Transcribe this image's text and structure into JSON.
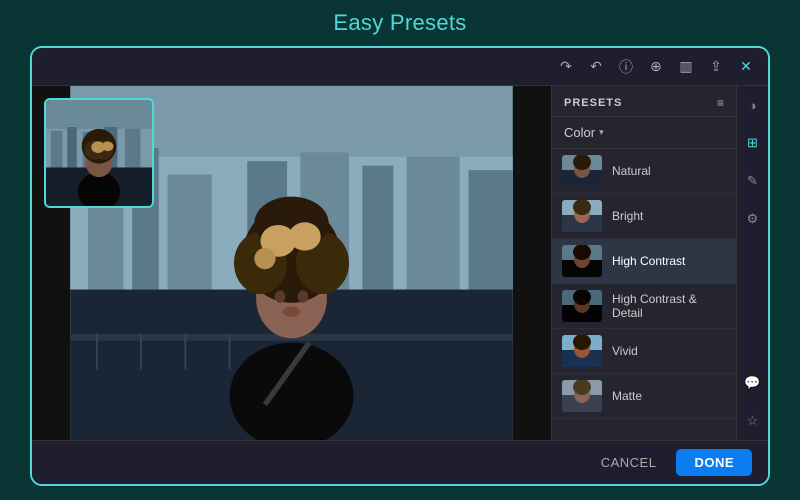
{
  "page": {
    "title": "Easy Presets",
    "background_color": "#0a3535",
    "accent_color": "#4fd8d8"
  },
  "toolbar": {
    "icons": [
      "redo",
      "undo",
      "info",
      "add",
      "compare",
      "share",
      "settings"
    ]
  },
  "presets_panel": {
    "title": "PRESETS",
    "filter_label": "Color",
    "items": [
      {
        "id": 1,
        "name": "Natural",
        "active": false
      },
      {
        "id": 2,
        "name": "Bright",
        "active": false
      },
      {
        "id": 3,
        "name": "High Contrast",
        "active": true
      },
      {
        "id": 4,
        "name": "High Contrast & Detail",
        "active": false
      },
      {
        "id": 5,
        "name": "Vivid",
        "active": false
      },
      {
        "id": 6,
        "name": "Matte",
        "active": false
      }
    ]
  },
  "right_sidebar": {
    "icons": [
      "circle-half",
      "person-crop",
      "pencil",
      "gear",
      "chat",
      "star"
    ]
  },
  "bottom_bar": {
    "cancel_label": "CANCEL",
    "done_label": "DONE"
  }
}
